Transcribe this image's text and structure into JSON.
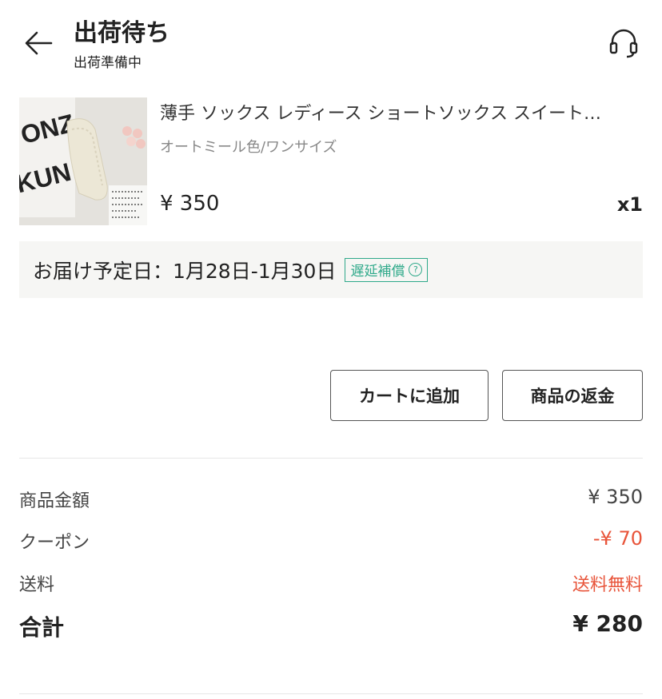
{
  "header": {
    "title": "出荷待ち",
    "subtitle": "出荷準備中"
  },
  "product": {
    "name": "薄手 ソックス レディース ショートソックス スイート…",
    "variant": "オートミール色/ワンサイズ",
    "price": "¥ 350",
    "quantity": "x1",
    "thumbnail_text": "ONZO KUN"
  },
  "delivery": {
    "text": "お届け予定日：1月28日-1月30日",
    "badge": "遅延補償",
    "badge_icon": "?"
  },
  "actions": {
    "add_to_cart": "カートに追加",
    "refund": "商品の返金"
  },
  "summary": {
    "subtotal_label": "商品金額",
    "subtotal_value": "¥ 350",
    "coupon_label": "クーポン",
    "coupon_value": "-¥ 70",
    "shipping_label": "送料",
    "shipping_value": "送料無料",
    "total_label": "合計",
    "total_value": "¥ 280"
  },
  "colors": {
    "accent_green": "#2fa98a",
    "discount_red": "#e8543a"
  }
}
